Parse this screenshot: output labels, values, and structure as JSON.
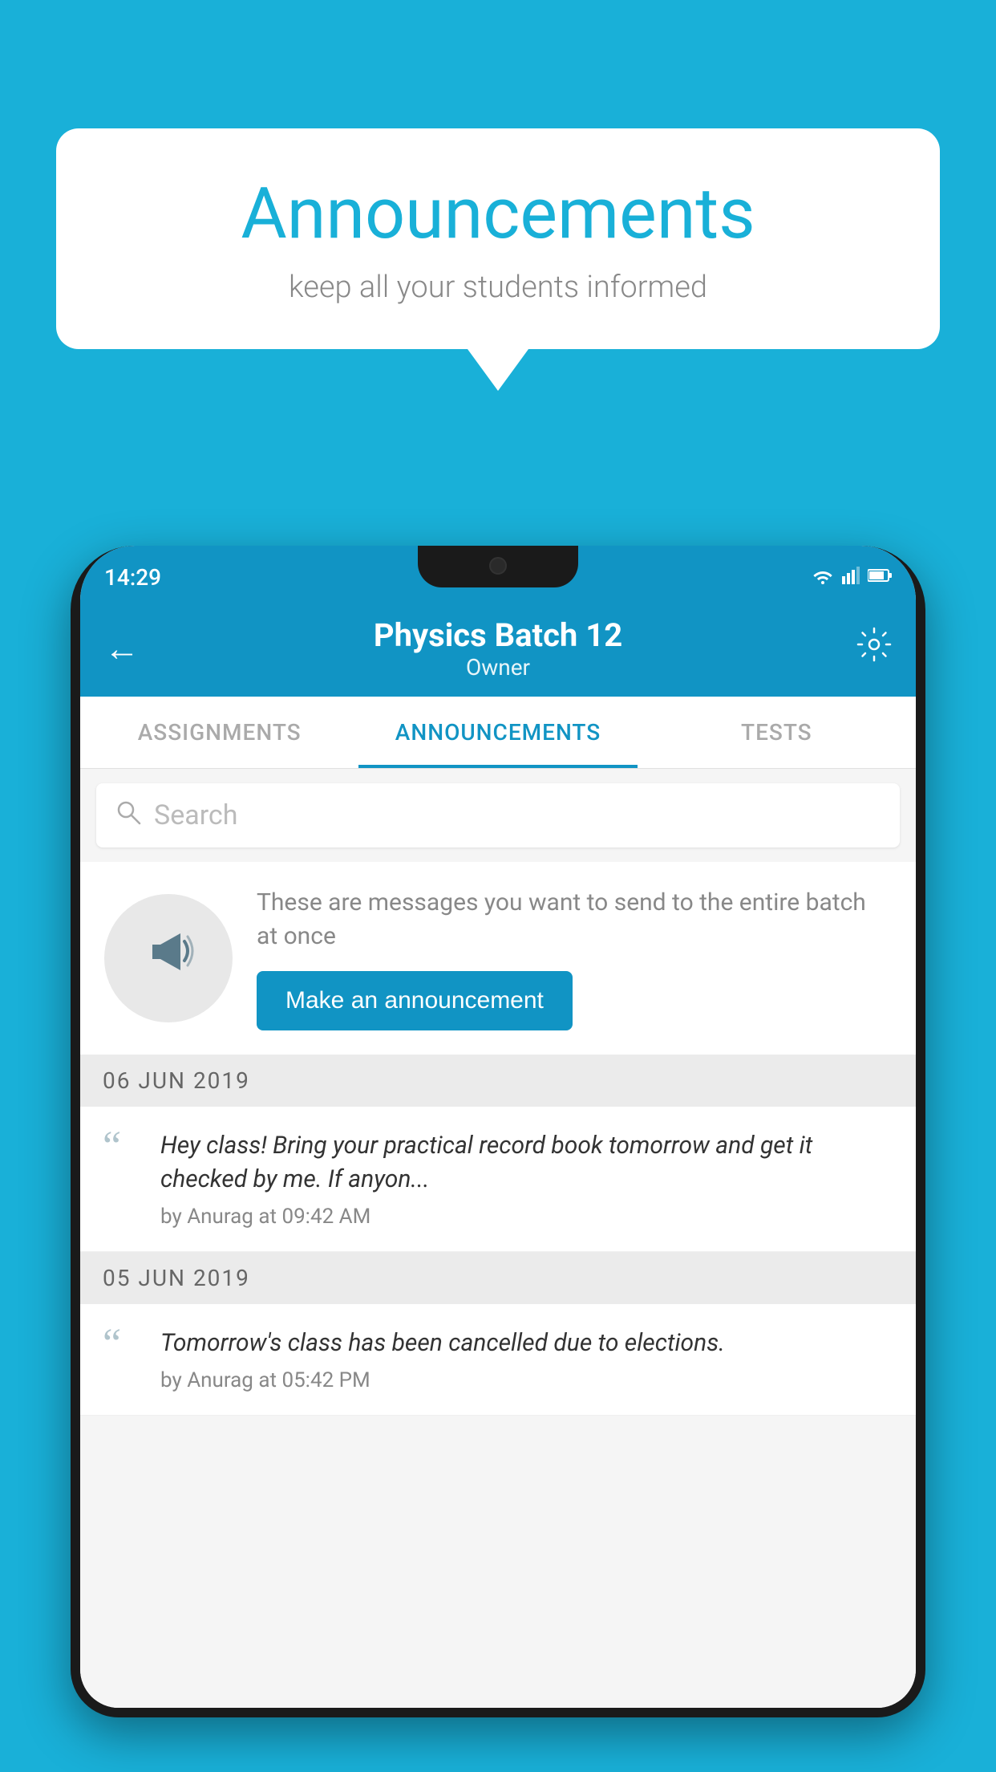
{
  "background_color": "#19B0D8",
  "speech_bubble": {
    "title": "Announcements",
    "subtitle": "keep all your students informed"
  },
  "status_bar": {
    "time": "14:29"
  },
  "app_bar": {
    "title": "Physics Batch 12",
    "subtitle": "Owner",
    "back_label": "←",
    "settings_label": "⚙"
  },
  "tabs": [
    {
      "label": "ASSIGNMENTS",
      "active": false
    },
    {
      "label": "ANNOUNCEMENTS",
      "active": true
    },
    {
      "label": "TESTS",
      "active": false
    }
  ],
  "search": {
    "placeholder": "Search"
  },
  "promo": {
    "description": "These are messages you want to send to the entire batch at once",
    "button_label": "Make an announcement"
  },
  "announcements": [
    {
      "date": "06  JUN  2019",
      "text": "Hey class! Bring your practical record book tomorrow and get it checked by me. If anyon...",
      "meta": "by Anurag at 09:42 AM"
    },
    {
      "date": "05  JUN  2019",
      "text": "Tomorrow's class has been cancelled due to elections.",
      "meta": "by Anurag at 05:42 PM"
    }
  ]
}
